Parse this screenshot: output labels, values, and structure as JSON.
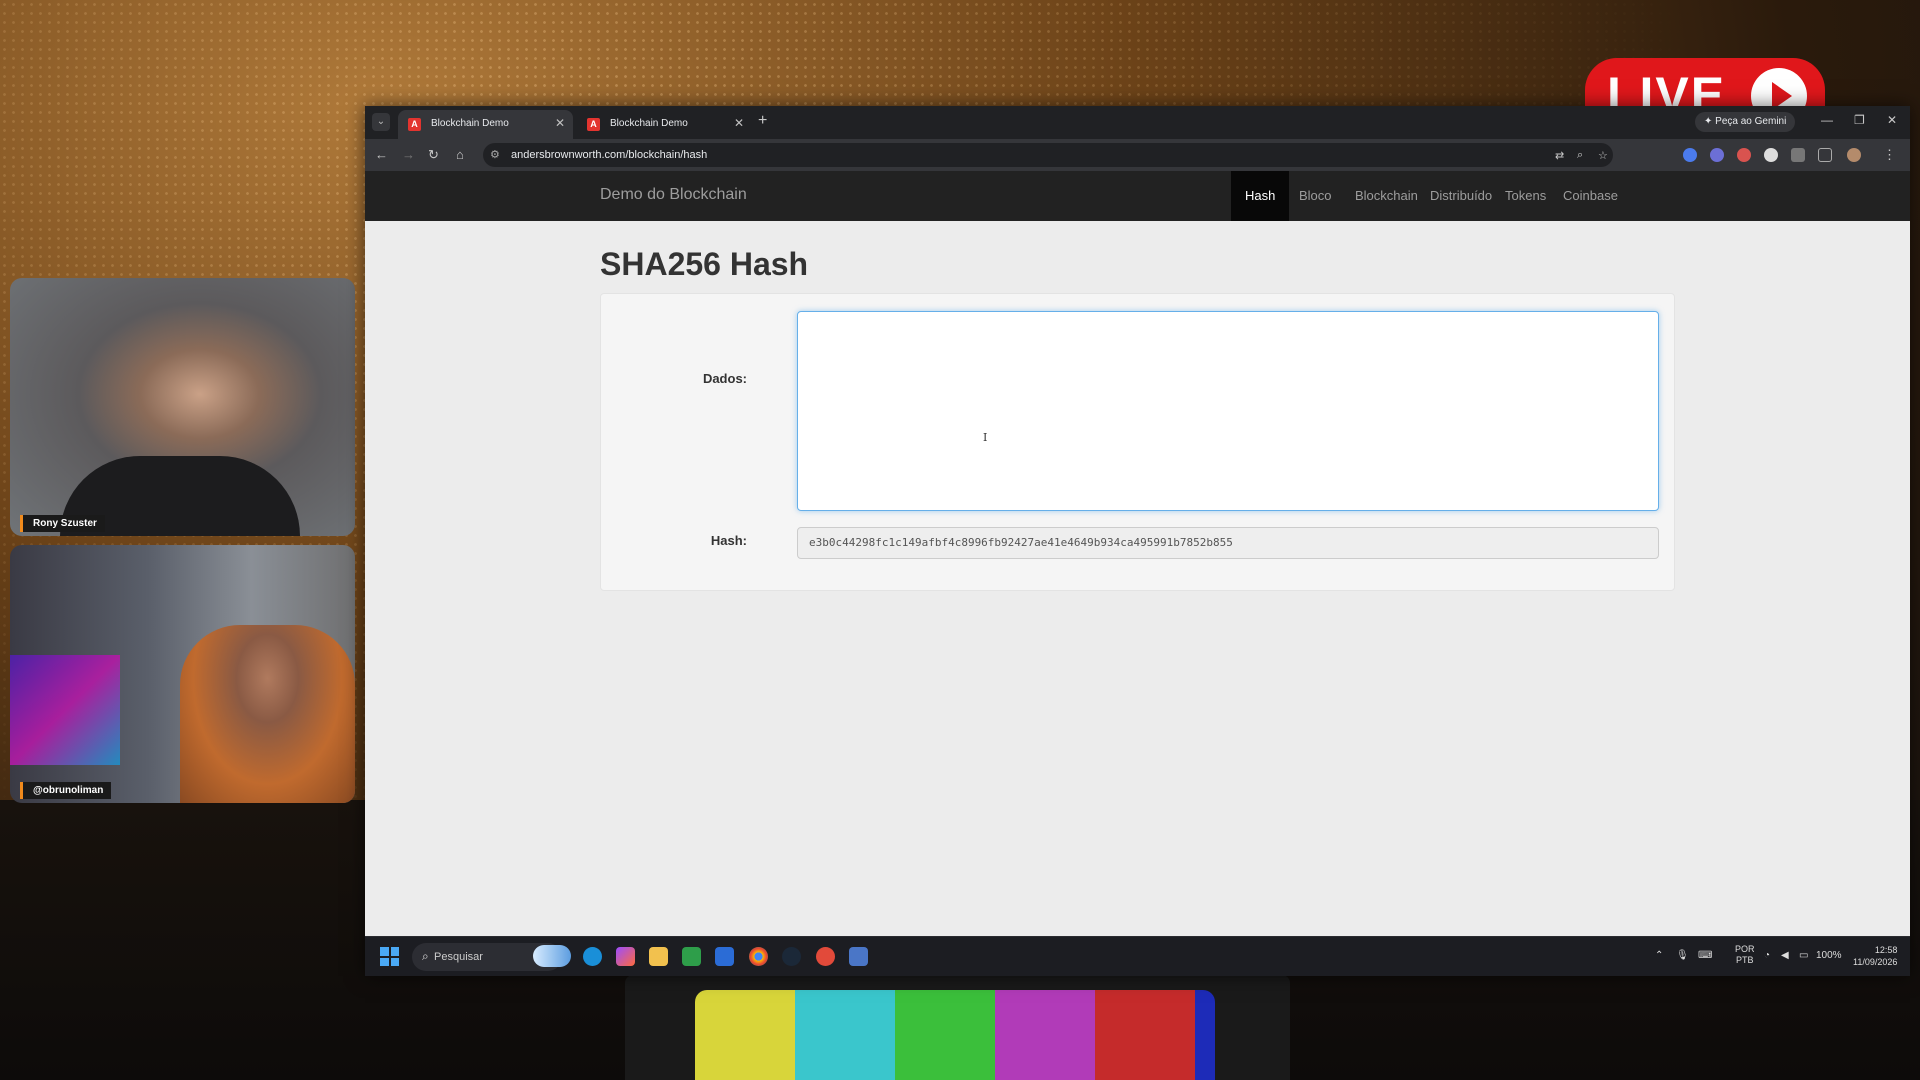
{
  "overlay": {
    "live_badge": "LIVE",
    "cam1_name": "Rony Szuster",
    "cam2_name": "@obrunoliman"
  },
  "browser": {
    "tabs": [
      {
        "label": "Blockchain Demo",
        "active": true
      },
      {
        "label": "Blockchain Demo",
        "active": false
      }
    ],
    "gemini_label": "Peça ao Gemini",
    "url": "andersbrownworth.com/blockchain/hash"
  },
  "site": {
    "brand": "Demo do Blockchain",
    "nav": [
      "Hash",
      "Bloco",
      "Blockchain",
      "Distribuído",
      "Tokens",
      "Coinbase"
    ],
    "active_nav": "Hash"
  },
  "page": {
    "title": "SHA256 Hash",
    "data_label": "Dados:",
    "data_value": "",
    "hash_label": "Hash:",
    "hash_value": "e3b0c44298fc1c149afbf4c8996fb92427ae41e4649b934ca495991b7852b855"
  },
  "taskbar": {
    "search_placeholder": "Pesquisar",
    "lang_top": "POR",
    "lang_bottom": "PTB",
    "battery": "100%",
    "time": "12:58",
    "date": "11/09/2026"
  }
}
